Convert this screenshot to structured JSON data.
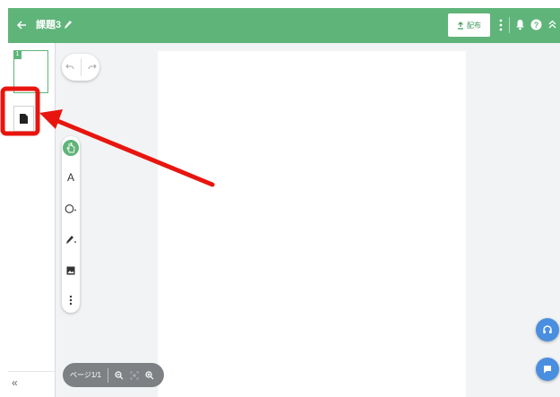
{
  "header": {
    "back_icon": "arrow-left-icon",
    "title": "課題3",
    "edit_icon": "pencil-icon",
    "publish_label": "配布",
    "publish_icon": "upload-icon",
    "more_icon": "more-vert-icon",
    "bell_icon": "bell-icon",
    "help_icon": "help-circle-icon",
    "collapse_icon": "double-chevron-up-icon",
    "bg_color": "#5fb47a"
  },
  "sidebar": {
    "page_thumbnail_number": "1",
    "add_document_icon": "document-icon",
    "collapse_label": "«"
  },
  "toolbar": {
    "undo_icon": "undo-icon",
    "redo_icon": "redo-icon",
    "tools": [
      "pointer-icon",
      "text-icon",
      "shape-icon",
      "pen-icon",
      "image-icon",
      "more-icon"
    ],
    "text_tool_label": "A"
  },
  "page_control": {
    "page_label": "ページ1/1",
    "zoom_out_icon": "zoom-out-icon",
    "fit_icon": "fit-screen-icon",
    "zoom_in_icon": "zoom-in-icon"
  },
  "fabs": [
    "headset-icon",
    "chat-icon"
  ],
  "annotation": {
    "highlight_color": "#e8150f"
  }
}
